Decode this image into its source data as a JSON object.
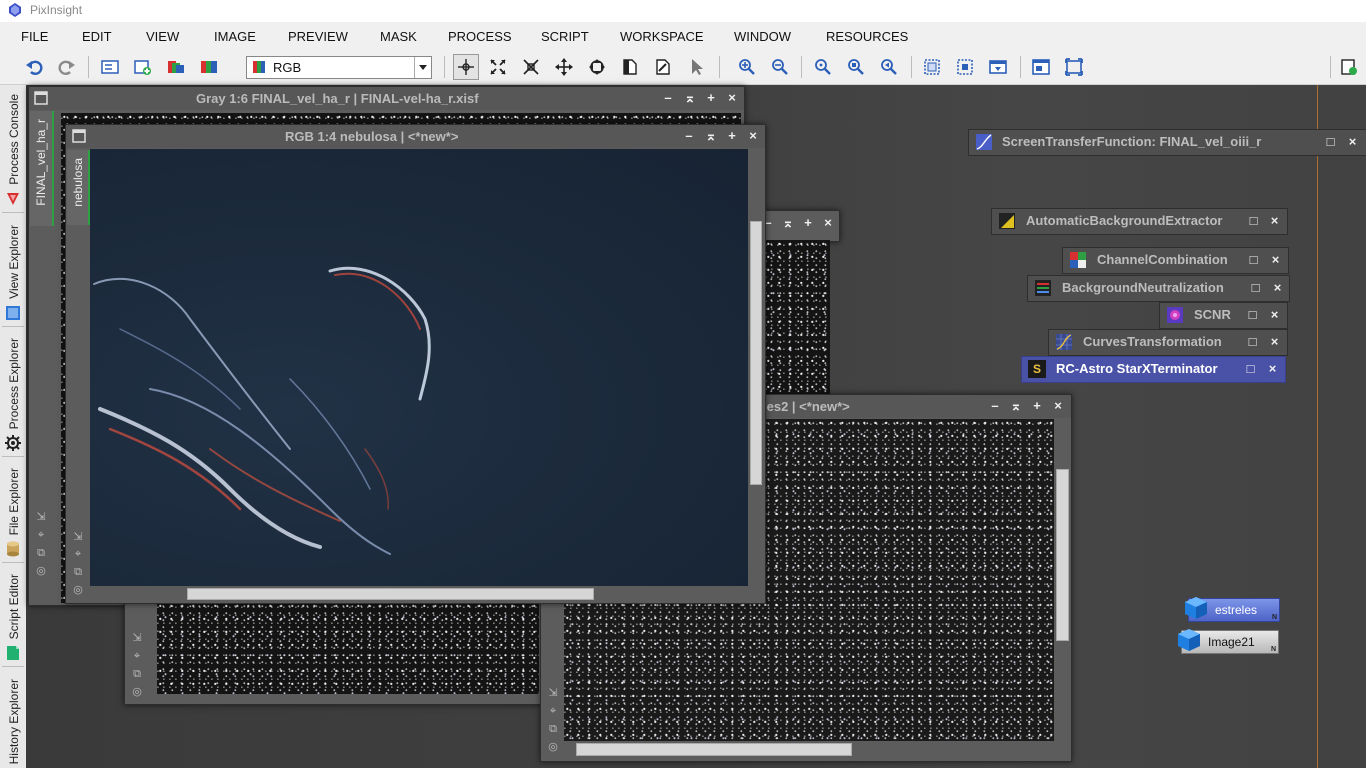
{
  "app": {
    "title": "PixInsight"
  },
  "menu": [
    "FILE",
    "EDIT",
    "VIEW",
    "IMAGE",
    "PREVIEW",
    "MASK",
    "PROCESS",
    "SCRIPT",
    "WORKSPACE",
    "WINDOW",
    "RESOURCES"
  ],
  "toolbar": {
    "channel_combo_value": "RGB"
  },
  "side_panels": {
    "process_console": "Process Console",
    "view_explorer": "View Explorer",
    "process_explorer": "Process Explorer",
    "file_explorer": "File Explorer",
    "script_editor": "Script Editor",
    "history_explorer": "History Explorer"
  },
  "windows": {
    "gray": {
      "title": "Gray 1:6 FINAL_vel_ha_r | FINAL-vel-ha_r.xisf",
      "side_label": "FINAL_vel_ha_r"
    },
    "rgb": {
      "title": "RGB 1:4 nebulosa | <*new*>",
      "side_label": "nebulosa"
    },
    "estrelles2": {
      "title": "les2 | <*new*>"
    }
  },
  "process_icons": {
    "stf": "ScreenTransferFunction: FINAL_vel_oiii_r",
    "abe": "AutomaticBackgroundExtractor",
    "channel": "ChannelCombination",
    "bgneutral": "BackgroundNeutralization",
    "scnr": "SCNR",
    "curves": "CurvesTransformation",
    "starx": "RC-Astro StarXTerminator",
    "starx_badge": "S"
  },
  "image_icons": {
    "estreles": "estreles",
    "image21": "Image21",
    "badge": "N"
  },
  "colors": {
    "accent_selected": "#4a52a8",
    "tab_indicator": "#2ea043"
  }
}
